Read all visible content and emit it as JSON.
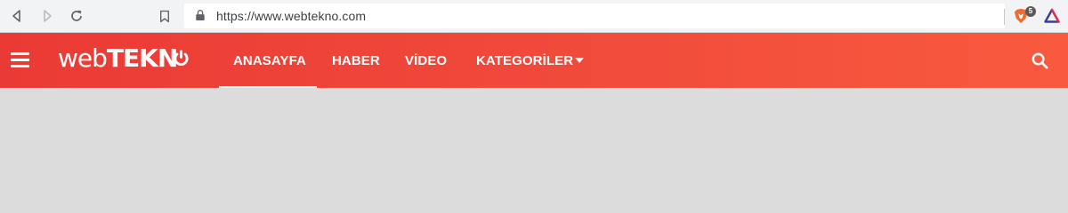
{
  "browser": {
    "url": "https://www.webtekno.com",
    "brave_badge_count": "5",
    "icons": [
      "back-icon",
      "forward-icon",
      "reload-icon",
      "bookmark-icon",
      "lock-icon",
      "brave-shield-icon",
      "prism-triangle-icon"
    ]
  },
  "site": {
    "logo_light": "web",
    "logo_bold": "TEKN",
    "nav": {
      "home": "ANASAYFA",
      "news": "HABER",
      "video": "VİDEO",
      "categories": "KATEGORİLER"
    },
    "active_tab": "ANASAYFA",
    "colors": {
      "header_start": "#ea3a35",
      "header_end": "#f95a3e",
      "page_background": "#dcdcdc"
    }
  }
}
